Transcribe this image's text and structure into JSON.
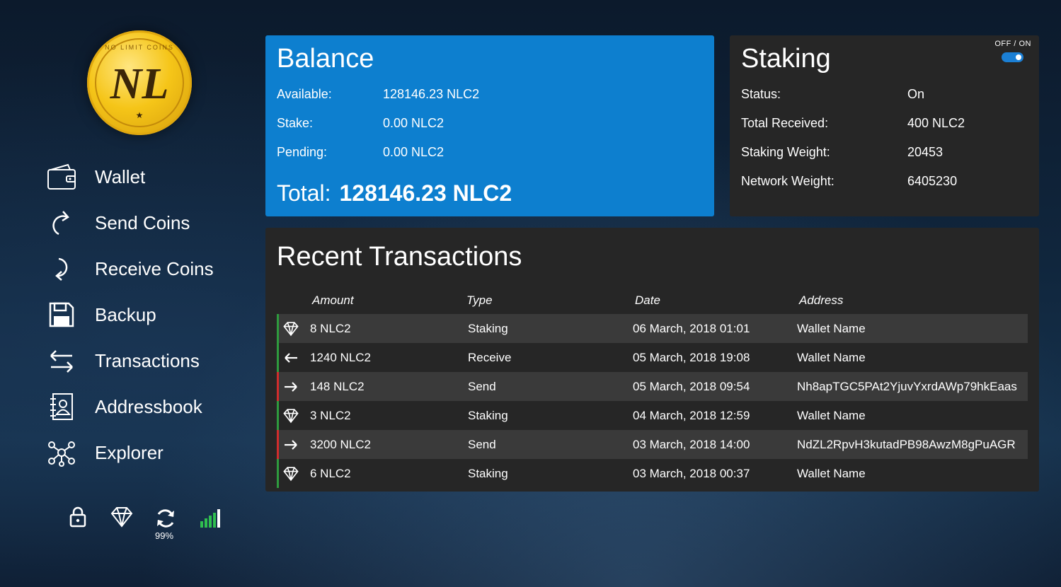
{
  "logo": {
    "emblem": "NL",
    "ring_text": "NO LIMIT COINS",
    "star": "★"
  },
  "nav": [
    {
      "label": "Wallet",
      "icon": "wallet-icon"
    },
    {
      "label": "Send Coins",
      "icon": "send-icon"
    },
    {
      "label": "Receive Coins",
      "icon": "receive-icon"
    },
    {
      "label": "Backup",
      "icon": "floppy-icon"
    },
    {
      "label": "Transactions",
      "icon": "transfer-arrows-icon"
    },
    {
      "label": "Addressbook",
      "icon": "addressbook-icon"
    },
    {
      "label": "Explorer",
      "icon": "network-icon"
    }
  ],
  "status": {
    "lock": "lock-icon",
    "staking": "diamond-icon",
    "sync": "sync-icon",
    "sync_percent": "99%",
    "signal": "signal-icon"
  },
  "balance": {
    "title": "Balance",
    "available_label": "Available:",
    "available_value": "128146.23 NLC2",
    "stake_label": "Stake:",
    "stake_value": "0.00 NLC2",
    "pending_label": "Pending:",
    "pending_value": "0.00 NLC2",
    "total_label": "Total:",
    "total_value": "128146.23 NLC2"
  },
  "staking": {
    "title": "Staking",
    "toggle_label": "OFF / ON",
    "toggle_on": true,
    "status_label": "Status:",
    "status_value": "On",
    "received_label": "Total Received:",
    "received_value": "400 NLC2",
    "weight_label": "Staking Weight:",
    "weight_value": "20453",
    "network_label": "Network Weight:",
    "network_value": "6405230"
  },
  "transactions": {
    "title": "Recent Transactions",
    "headers": {
      "amount": "Amount",
      "type": "Type",
      "date": "Date",
      "address": "Address"
    },
    "rows": [
      {
        "kind": "staking",
        "amount": "8 NLC2",
        "type": "Staking",
        "date": "06 March, 2018 01:01",
        "address": "Wallet Name"
      },
      {
        "kind": "receive",
        "amount": "1240 NLC2",
        "type": "Receive",
        "date": "05 March, 2018 19:08",
        "address": "Wallet Name"
      },
      {
        "kind": "send",
        "amount": "148 NLC2",
        "type": "Send",
        "date": "05 March, 2018 09:54",
        "address": "Nh8apTGC5PAt2YjuvYxrdAWp79hkEaas"
      },
      {
        "kind": "staking",
        "amount": "3 NLC2",
        "type": "Staking",
        "date": "04 March, 2018 12:59",
        "address": "Wallet Name"
      },
      {
        "kind": "send",
        "amount": "3200 NLC2",
        "type": "Send",
        "date": "03 March, 2018 14:00",
        "address": "NdZL2RpvH3kutadPB98AwzM8gPuAGR"
      },
      {
        "kind": "staking",
        "amount": "6 NLC2",
        "type": "Staking",
        "date": "03 March, 2018 00:37",
        "address": "Wallet Name"
      }
    ]
  },
  "colors": {
    "balance_bg": "#0d7fcf",
    "panel_bg": "#262626",
    "incoming_bar": "#2e9b3e",
    "outgoing_bar": "#d12c2c",
    "toggle": "#1b7fd4"
  }
}
